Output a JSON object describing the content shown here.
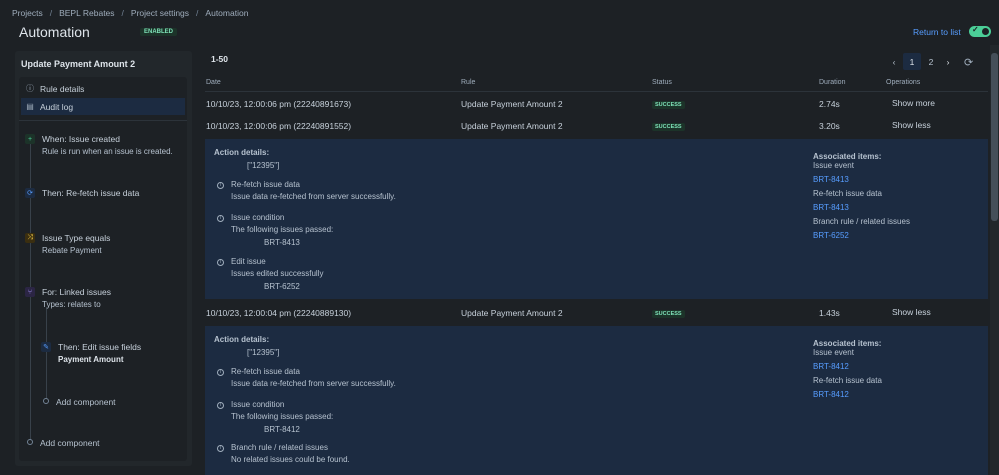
{
  "breadcrumb": [
    "Projects",
    "BEPL Rebates",
    "Project settings",
    "Automation"
  ],
  "page": {
    "title": "Automation",
    "status_badge": "ENABLED",
    "return_link": "Return to list"
  },
  "sidebar": {
    "rule_name": "Update Payment Amount 2",
    "nav": [
      {
        "label": "Rule details",
        "icon": "info-icon"
      },
      {
        "label": "Audit log",
        "icon": "document-icon"
      }
    ],
    "steps": [
      {
        "title": "When: Issue created",
        "subtitle": "Rule is run when an issue is created.",
        "icon": "plus-icon",
        "color": "#4bce97"
      },
      {
        "title": "Then: Re-fetch issue data",
        "subtitle": "",
        "icon": "refresh-icon",
        "color": "#579dff"
      },
      {
        "title": "Issue Type equals",
        "subtitle": "Rebate Payment",
        "icon": "shuffle-icon",
        "color": "#f5cd47"
      },
      {
        "title": "For: Linked issues",
        "subtitle": "Types: relates to",
        "icon": "branch-icon",
        "color": "#9f8fef"
      },
      {
        "title": "Then: Edit issue fields",
        "subtitle": "Payment Amount",
        "icon": "pencil-icon",
        "color": "#579dff"
      }
    ],
    "add_component_inner": "Add component",
    "add_component_outer": "Add component"
  },
  "table": {
    "range": "1-50",
    "pages": [
      "1",
      "2"
    ],
    "current_page": "1",
    "headers": {
      "date": "Date",
      "rule": "Rule",
      "status": "Status",
      "duration": "Duration",
      "operations": "Operations"
    },
    "rows": [
      {
        "date": "10/10/23, 12:00:06 pm (22240891673)",
        "rule": "Update Payment Amount 2",
        "status": "SUCCESS",
        "duration": "2.74s",
        "operation": "Show more"
      },
      {
        "date": "10/10/23, 12:00:06 pm (22240891552)",
        "rule": "Update Payment Amount 2",
        "status": "SUCCESS",
        "duration": "3.20s",
        "operation": "Show less"
      },
      {
        "date": "10/10/23, 12:00:04 pm (22240889130)",
        "rule": "Update Payment Amount 2",
        "status": "SUCCESS",
        "duration": "1.43s",
        "operation": "Show less"
      }
    ]
  },
  "details": [
    {
      "heading": "Action details:",
      "issue_keys": "[\"12395\"]",
      "actions": [
        {
          "title": "Re-fetch issue data",
          "lines": [
            "Issue data re-fetched from server successfully."
          ]
        },
        {
          "title": "Issue condition",
          "lines": [
            "The following issues passed:"
          ],
          "indented": "BRT-8413"
        },
        {
          "title": "Edit issue",
          "lines": [
            "Issues edited successfully"
          ],
          "indented": "BRT-6252"
        }
      ],
      "associated": {
        "heading": "Associated items:",
        "items": [
          {
            "label": "Issue event",
            "link": "BRT-8413"
          },
          {
            "label": "Re-fetch issue data",
            "link": "BRT-8413"
          },
          {
            "label": "Branch rule / related issues",
            "link": "BRT-6252"
          }
        ]
      }
    },
    {
      "heading": "Action details:",
      "issue_keys": "[\"12395\"]",
      "actions": [
        {
          "title": "Re-fetch issue data",
          "lines": [
            "Issue data re-fetched from server successfully."
          ]
        },
        {
          "title": "Issue condition",
          "lines": [
            "The following issues passed:"
          ],
          "indented": "BRT-8412"
        },
        {
          "title": "Branch rule / related issues",
          "lines": [
            "No related issues could be found."
          ]
        }
      ],
      "associated": {
        "heading": "Associated items:",
        "items": [
          {
            "label": "Issue event",
            "link": "BRT-8412"
          },
          {
            "label": "Re-fetch issue data",
            "link": "BRT-8412"
          }
        ]
      }
    }
  ]
}
